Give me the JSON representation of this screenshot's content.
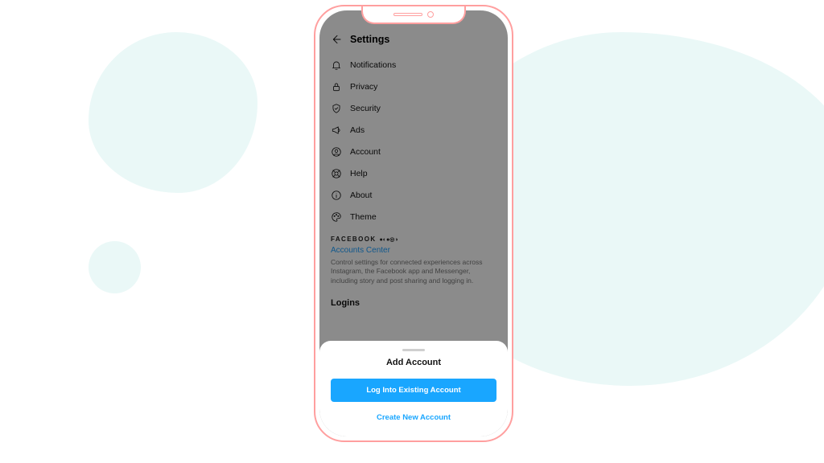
{
  "header": {
    "title": "Settings"
  },
  "menu": {
    "items": [
      {
        "label": "Notifications"
      },
      {
        "label": "Privacy"
      },
      {
        "label": "Security"
      },
      {
        "label": "Ads"
      },
      {
        "label": "Account"
      },
      {
        "label": "Help"
      },
      {
        "label": "About"
      },
      {
        "label": "Theme"
      }
    ]
  },
  "brand": {
    "name": "FACEBOOK",
    "icons_glyphs": "●◐●◎◑"
  },
  "accounts_center": {
    "link": "Accounts Center",
    "desc": "Control settings for connected experiences across Instagram, the Facebook app and Messenger, including story and post sharing and logging in."
  },
  "section": {
    "logins": "Logins"
  },
  "sheet": {
    "title": "Add Account",
    "primary": "Log Into Existing Account",
    "secondary": "Create New Account"
  }
}
